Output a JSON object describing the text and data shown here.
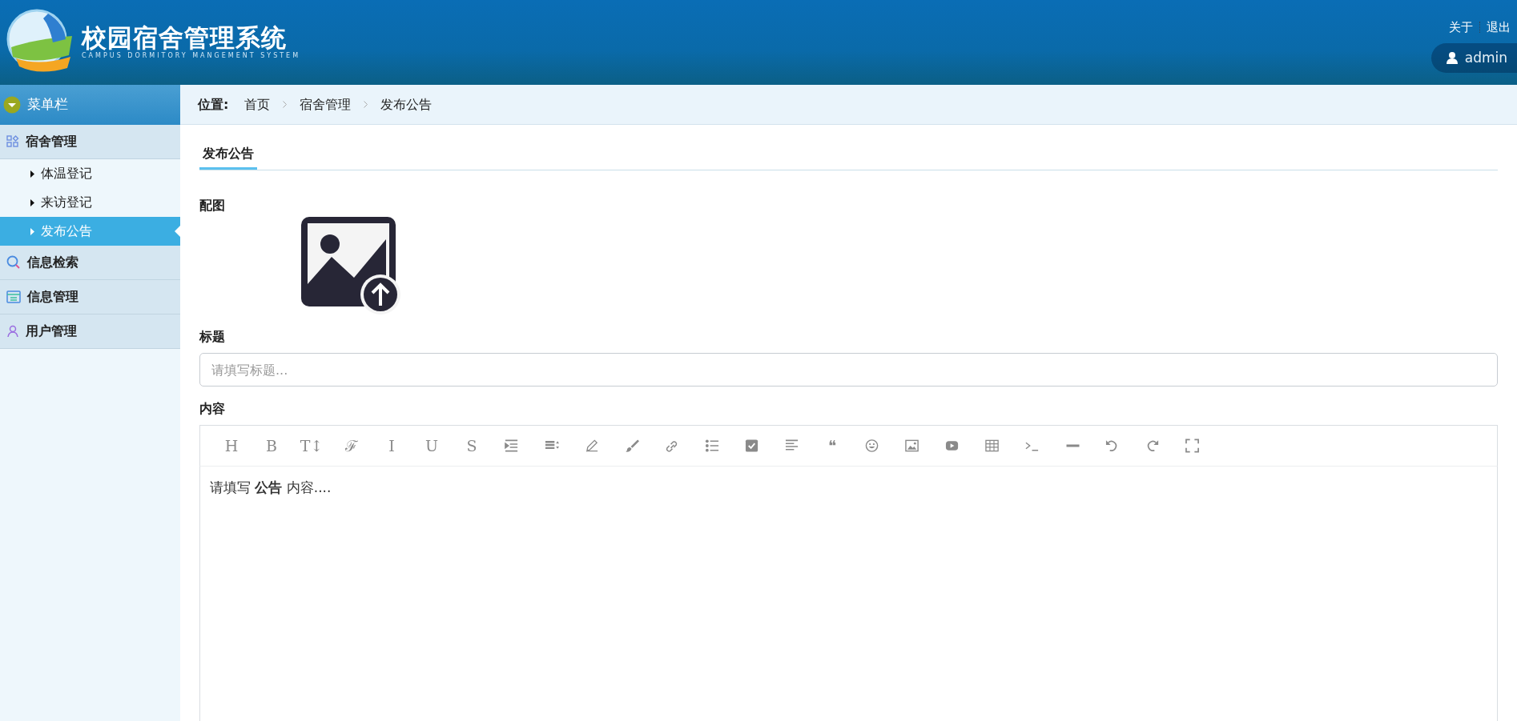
{
  "header": {
    "title": "校园宿舍管理系统",
    "subtitle": "CAMPUS DORMITORY MANGEMENT SYSTEM",
    "links": [
      "关于",
      "退出"
    ],
    "user": "admin"
  },
  "sidebar": {
    "title": "菜单栏",
    "groups": [
      {
        "label": "宿舍管理",
        "children": [
          {
            "label": "体温登记",
            "selected": false
          },
          {
            "label": "来访登记",
            "selected": false
          },
          {
            "label": "发布公告",
            "selected": true
          }
        ]
      },
      {
        "label": "信息检索"
      },
      {
        "label": "信息管理"
      },
      {
        "label": "用户管理"
      }
    ]
  },
  "breadcrumb": {
    "label": "位置:",
    "items": [
      "首页",
      "宿舍管理",
      "发布公告"
    ]
  },
  "tab": "发布公告",
  "form": {
    "image_label": "配图",
    "title_label": "标题",
    "title_placeholder": "请填写标题...",
    "content_label": "内容",
    "content_text": "请填写 **公告** 内容...."
  },
  "toolbar": [
    {
      "kind": "letter",
      "glyph": "H"
    },
    {
      "kind": "letter",
      "glyph": "B"
    },
    {
      "kind": "letter",
      "glyph": "T↕"
    },
    {
      "kind": "letter",
      "glyph": "ℱ"
    },
    {
      "kind": "letter",
      "glyph": "I"
    },
    {
      "kind": "letter",
      "glyph": "U"
    },
    {
      "kind": "letter",
      "glyph": "S"
    },
    {
      "kind": "indent"
    },
    {
      "kind": "line-height"
    },
    {
      "kind": "pen"
    },
    {
      "kind": "brush"
    },
    {
      "kind": "link"
    },
    {
      "kind": "list"
    },
    {
      "kind": "checkbox"
    },
    {
      "kind": "align"
    },
    {
      "kind": "letter",
      "glyph": "❝"
    },
    {
      "kind": "emoji"
    },
    {
      "kind": "image"
    },
    {
      "kind": "video"
    },
    {
      "kind": "table"
    },
    {
      "kind": "code"
    },
    {
      "kind": "rule"
    },
    {
      "kind": "undo"
    },
    {
      "kind": "redo"
    },
    {
      "kind": "fullscreen"
    }
  ]
}
